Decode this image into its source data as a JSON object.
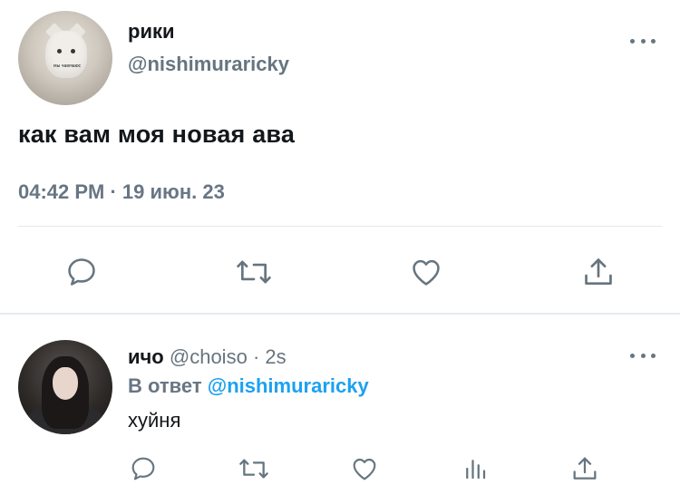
{
  "main_tweet": {
    "avatar_caption": "мы чаемаюс",
    "display_name": "рики",
    "handle": "@nishimuraricky",
    "text": "как вам моя новая ава",
    "timestamp": "04:42 PM · 19 июн. 23"
  },
  "reply": {
    "display_name": "ичо",
    "handle": "@choiso",
    "time": "2s",
    "reply_prefix": "В ответ",
    "reply_mention": "@nishimuraricky",
    "text": "хуйня"
  },
  "icons": {
    "main_actions": [
      "reply-icon",
      "retweet-icon",
      "like-icon",
      "share-icon"
    ],
    "reply_actions": [
      "reply-icon",
      "retweet-icon",
      "like-icon",
      "analytics-icon",
      "share-icon"
    ],
    "more": "more-icon"
  },
  "colors": {
    "text_primary": "#14171a",
    "text_secondary": "#687684",
    "link": "#1da1f2",
    "divider": "#e1e8ed"
  }
}
